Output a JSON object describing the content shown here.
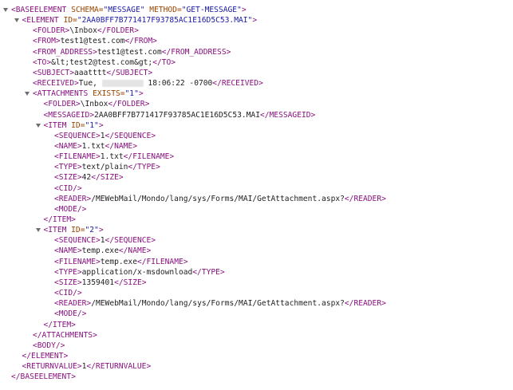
{
  "lines": [
    {
      "indent": 0,
      "toggle": true,
      "parts": [
        {
          "t": "tag",
          "v": "<BASEELEMENT "
        },
        {
          "t": "attr-name",
          "v": "SCHEMA="
        },
        {
          "t": "attr-val",
          "v": "\"MESSAGE\""
        },
        {
          "t": "tag",
          "v": " "
        },
        {
          "t": "attr-name",
          "v": "METHOD="
        },
        {
          "t": "attr-val",
          "v": "\"GET-MESSAGE\""
        },
        {
          "t": "tag",
          "v": ">"
        }
      ]
    },
    {
      "indent": 1,
      "toggle": true,
      "parts": [
        {
          "t": "tag",
          "v": "<ELEMENT "
        },
        {
          "t": "attr-name",
          "v": "ID="
        },
        {
          "t": "attr-val",
          "v": "\"2AA0BFF7B771417F93785AC1E16D5C53.MAI\""
        },
        {
          "t": "tag",
          "v": ">"
        }
      ]
    },
    {
      "indent": 2,
      "parts": [
        {
          "t": "tag",
          "v": "<FOLDER>"
        },
        {
          "t": "text",
          "v": "\\Inbox"
        },
        {
          "t": "tag",
          "v": "</FOLDER>"
        }
      ]
    },
    {
      "indent": 2,
      "parts": [
        {
          "t": "tag",
          "v": "<FROM>"
        },
        {
          "t": "text",
          "v": "test1@test.com"
        },
        {
          "t": "tag",
          "v": "</FROM>"
        }
      ]
    },
    {
      "indent": 2,
      "parts": [
        {
          "t": "tag",
          "v": "<FROM_ADDRESS>"
        },
        {
          "t": "text",
          "v": "test1@test.com"
        },
        {
          "t": "tag",
          "v": "</FROM_ADDRESS>"
        }
      ]
    },
    {
      "indent": 2,
      "parts": [
        {
          "t": "tag",
          "v": "<TO>"
        },
        {
          "t": "text",
          "v": "&lt;test2@test.com&gt;"
        },
        {
          "t": "tag",
          "v": "</TO>"
        }
      ]
    },
    {
      "indent": 2,
      "parts": [
        {
          "t": "tag",
          "v": "<SUBJECT>"
        },
        {
          "t": "text",
          "v": "aaatttt"
        },
        {
          "t": "tag",
          "v": "</SUBJECT>"
        }
      ]
    },
    {
      "indent": 2,
      "parts": [
        {
          "t": "tag",
          "v": "<RECEIVED>"
        },
        {
          "t": "text",
          "v": "Tue, "
        },
        {
          "t": "redacted",
          "v": ""
        },
        {
          "t": "text",
          "v": " 18:06:22 -0700"
        },
        {
          "t": "tag",
          "v": "</RECEIVED>"
        }
      ]
    },
    {
      "indent": 2,
      "toggle": true,
      "parts": [
        {
          "t": "tag",
          "v": "<ATTACHMENTS "
        },
        {
          "t": "attr-name",
          "v": "EXISTS="
        },
        {
          "t": "attr-val",
          "v": "\"1\""
        },
        {
          "t": "tag",
          "v": ">"
        }
      ]
    },
    {
      "indent": 3,
      "parts": [
        {
          "t": "tag",
          "v": "<FOLDER>"
        },
        {
          "t": "text",
          "v": "\\Inbox"
        },
        {
          "t": "tag",
          "v": "</FOLDER>"
        }
      ]
    },
    {
      "indent": 3,
      "parts": [
        {
          "t": "tag",
          "v": "<MESSAGEID>"
        },
        {
          "t": "text",
          "v": "2AA0BFF7B771417F93785AC1E16D5C53.MAI"
        },
        {
          "t": "tag",
          "v": "</MESSAGEID>"
        }
      ]
    },
    {
      "indent": 3,
      "toggle": true,
      "parts": [
        {
          "t": "tag",
          "v": "<ITEM "
        },
        {
          "t": "attr-name",
          "v": "ID="
        },
        {
          "t": "attr-val",
          "v": "\"1\""
        },
        {
          "t": "tag",
          "v": ">"
        }
      ]
    },
    {
      "indent": 4,
      "parts": [
        {
          "t": "tag",
          "v": "<SEQUENCE>"
        },
        {
          "t": "text",
          "v": "1"
        },
        {
          "t": "tag",
          "v": "</SEQUENCE>"
        }
      ]
    },
    {
      "indent": 4,
      "parts": [
        {
          "t": "tag",
          "v": "<NAME>"
        },
        {
          "t": "text",
          "v": "1.txt"
        },
        {
          "t": "tag",
          "v": "</NAME>"
        }
      ]
    },
    {
      "indent": 4,
      "parts": [
        {
          "t": "tag",
          "v": "<FILENAME>"
        },
        {
          "t": "text",
          "v": "1.txt"
        },
        {
          "t": "tag",
          "v": "</FILENAME>"
        }
      ]
    },
    {
      "indent": 4,
      "parts": [
        {
          "t": "tag",
          "v": "<TYPE>"
        },
        {
          "t": "text",
          "v": "text/plain"
        },
        {
          "t": "tag",
          "v": "</TYPE>"
        }
      ]
    },
    {
      "indent": 4,
      "parts": [
        {
          "t": "tag",
          "v": "<SIZE>"
        },
        {
          "t": "text",
          "v": "42"
        },
        {
          "t": "tag",
          "v": "</SIZE>"
        }
      ]
    },
    {
      "indent": 4,
      "parts": [
        {
          "t": "tag",
          "v": "<CID/>"
        }
      ]
    },
    {
      "indent": 4,
      "parts": [
        {
          "t": "tag",
          "v": "<READER>"
        },
        {
          "t": "text",
          "v": "/MEWebMail/Mondo/lang/sys/Forms/MAI/GetAttachment.aspx?"
        },
        {
          "t": "tag",
          "v": "</READER>"
        }
      ]
    },
    {
      "indent": 4,
      "parts": [
        {
          "t": "tag",
          "v": "<MODE/>"
        }
      ]
    },
    {
      "indent": 3,
      "parts": [
        {
          "t": "tag",
          "v": "</ITEM>"
        }
      ]
    },
    {
      "indent": 3,
      "toggle": true,
      "parts": [
        {
          "t": "tag",
          "v": "<ITEM "
        },
        {
          "t": "attr-name",
          "v": "ID="
        },
        {
          "t": "attr-val",
          "v": "\"2\""
        },
        {
          "t": "tag",
          "v": ">"
        }
      ]
    },
    {
      "indent": 4,
      "parts": [
        {
          "t": "tag",
          "v": "<SEQUENCE>"
        },
        {
          "t": "text",
          "v": "1"
        },
        {
          "t": "tag",
          "v": "</SEQUENCE>"
        }
      ]
    },
    {
      "indent": 4,
      "parts": [
        {
          "t": "tag",
          "v": "<NAME>"
        },
        {
          "t": "text",
          "v": "temp.exe"
        },
        {
          "t": "tag",
          "v": "</NAME>"
        }
      ]
    },
    {
      "indent": 4,
      "parts": [
        {
          "t": "tag",
          "v": "<FILENAME>"
        },
        {
          "t": "text",
          "v": "temp.exe"
        },
        {
          "t": "tag",
          "v": "</FILENAME>"
        }
      ]
    },
    {
      "indent": 4,
      "parts": [
        {
          "t": "tag",
          "v": "<TYPE>"
        },
        {
          "t": "text",
          "v": "application/x-msdownload"
        },
        {
          "t": "tag",
          "v": "</TYPE>"
        }
      ]
    },
    {
      "indent": 4,
      "parts": [
        {
          "t": "tag",
          "v": "<SIZE>"
        },
        {
          "t": "text",
          "v": "1359401"
        },
        {
          "t": "tag",
          "v": "</SIZE>"
        }
      ]
    },
    {
      "indent": 4,
      "parts": [
        {
          "t": "tag",
          "v": "<CID/>"
        }
      ]
    },
    {
      "indent": 4,
      "parts": [
        {
          "t": "tag",
          "v": "<READER>"
        },
        {
          "t": "text",
          "v": "/MEWebMail/Mondo/lang/sys/Forms/MAI/GetAttachment.aspx?"
        },
        {
          "t": "tag",
          "v": "</READER>"
        }
      ]
    },
    {
      "indent": 4,
      "parts": [
        {
          "t": "tag",
          "v": "<MODE/>"
        }
      ]
    },
    {
      "indent": 3,
      "parts": [
        {
          "t": "tag",
          "v": "</ITEM>"
        }
      ]
    },
    {
      "indent": 2,
      "parts": [
        {
          "t": "tag",
          "v": "</ATTACHMENTS>"
        }
      ]
    },
    {
      "indent": 2,
      "parts": [
        {
          "t": "tag",
          "v": "<BODY/>"
        }
      ]
    },
    {
      "indent": 1,
      "parts": [
        {
          "t": "tag",
          "v": "</ELEMENT>"
        }
      ]
    },
    {
      "indent": 1,
      "parts": [
        {
          "t": "tag",
          "v": "<RETURNVALUE>"
        },
        {
          "t": "text",
          "v": "1"
        },
        {
          "t": "tag",
          "v": "</RETURNVALUE>"
        }
      ]
    },
    {
      "indent": 0,
      "parts": [
        {
          "t": "tag",
          "v": "</BASEELEMENT>"
        }
      ]
    }
  ],
  "colors": {
    "tag": "#881280",
    "attr_name": "#994500",
    "attr_value": "#1a1aa6",
    "text": "#222222",
    "background": "#ffffff"
  },
  "icons": {
    "toggle": "triangle-down-icon",
    "redaction": "blurred-redaction"
  }
}
